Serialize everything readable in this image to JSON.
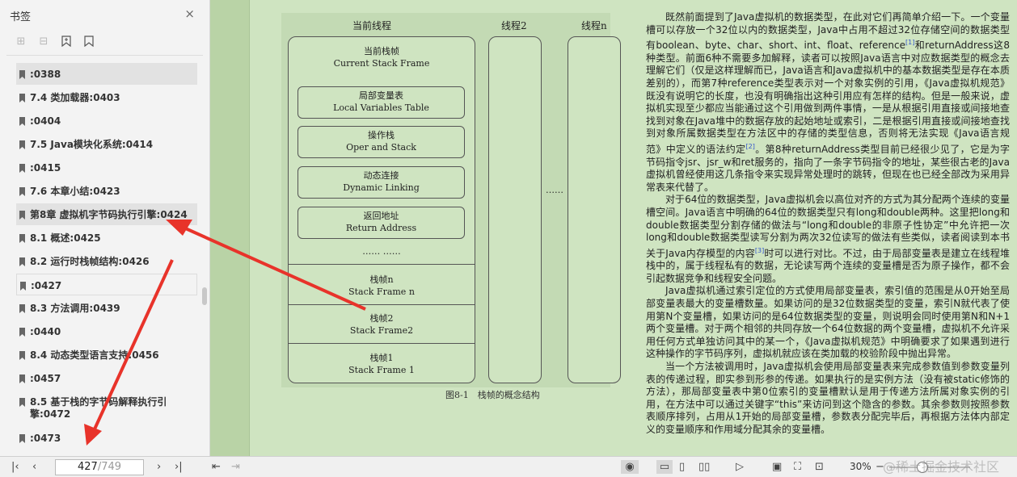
{
  "sidebar": {
    "title": "书签",
    "close": "×",
    "bookmarks": [
      ":0388",
      "7.4 类加载器:0403",
      ":0404",
      "7.5 Java模块化系统:0414",
      ":0415",
      "7.6 本章小结:0423",
      "第8章 虚拟机字节码执行引擎:0424",
      "8.1 概述:0425",
      "8.2 运行时栈帧结构:0426",
      ":0427",
      "8.3 方法调用:0439",
      ":0440",
      "8.4 动态类型语言支持:0456",
      ":0457",
      "8.5 基于栈的字节码解释执行引擎:0472",
      ":0473"
    ]
  },
  "figure": {
    "col1": "当前线程",
    "col2": "线程2",
    "col3": "线程n",
    "current_frame_cn": "当前栈帧",
    "current_frame_en": "Current Stack Frame",
    "lvt_cn": "局部变量表",
    "lvt_en": "Local Variables Table",
    "os_cn": "操作栈",
    "os_en": "Oper and Stack",
    "dl_cn": "动态连接",
    "dl_en": "Dynamic Linking",
    "ra_cn": "返回地址",
    "ra_en": "Return Address",
    "dots": "……  ……",
    "dots2": "……",
    "fn_cn": "栈帧n",
    "fn_en": "Stack Frame n",
    "f2_cn": "栈帧2",
    "f2_en": "Stack Frame2",
    "f1_cn": "栈帧1",
    "f1_en": "Stack Frame 1",
    "caption": "图8-1　栈帧的概念结构"
  },
  "text": {
    "p1a": "既然前面提到了Java虚拟机的数据类型，在此对它们再简单介绍一下。一个变量槽可以存放一个32位以内的数据类型，Java中占用不超过32位存储空间的数据类型有boolean、byte、char、short、int、float、reference",
    "p1sup1": "[1]",
    "p1b": "和returnAddress这8种类型。前面6种不需要多加解释，读者可以按照Java语言中对应数据类型的概念去理解它们（仅是这样理解而已，Java语言和Java虚拟机中的基本数据类型是存在本质差别的），而第7种reference类型表示对一个对象实例的引用，《Java虚拟机规范》既没有说明它的长度，也没有明确指出这种引用应有怎样的结构。但是一般来说，虚拟机实现至少都应当能通过这个引用做到两件事情，一是从根据引用直接或间接地查找到对象在Java堆中的数据存放的起始地址或索引，二是根据引用直接或间接地查找到对象所属数据类型在方法区中的存储的类型信息，否则将无法实现《Java语言规范》中定义的语法约定",
    "p1sup2": "[2]",
    "p1c": "。第8种returnAddress类型目前已经很少见了，它是为字节码指令jsr、jsr_w和ret服务的，指向了一条字节码指令的地址，某些很古老的Java虚拟机曾经使用这几条指令来实现异常处理时的跳转，但现在也已经全部改为采用异常表来代替了。",
    "p2a": "对于64位的数据类型，Java虚拟机会以高位对齐的方式为其分配两个连续的变量槽空间。Java语言中明确的64位的数据类型只有long和double两种。这里把long和double数据类型分割存储的做法与“long和double的非原子性协定”中允许把一次long和double数据类型读写分割为两次32位读写的做法有些类似，读者阅读到本书关于Java内存模型的内容",
    "p2sup": "[3]",
    "p2b": "时可以进行对比。不过，由于局部变量表是建立在线程堆栈中的，属于线程私有的数据，无论读写两个连续的变量槽是否为原子操作，都不会引起数据竞争和线程安全问题。",
    "p3": "Java虚拟机通过索引定位的方式使用局部变量表，索引值的范围是从0开始至局部变量表最大的变量槽数量。如果访问的是32位数据类型的变量，索引N就代表了使用第N个变量槽，如果访问的是64位数据类型的变量，则说明会同时使用第N和N+1两个变量槽。对于两个相邻的共同存放一个64位数据的两个变量槽，虚拟机不允许采用任何方式单独访问其中的某一个，《Java虚拟机规范》中明确要求了如果遇到进行这种操作的字节码序列，虚拟机就应该在类加载的校验阶段中抛出异常。",
    "p4": "当一个方法被调用时，Java虚拟机会使用局部变量表来完成参数值到参数变量列表的传递过程，即实参到形参的传递。如果执行的是实例方法（没有被static修饰的方法），那局部变量表中第0位索引的变量槽默认是用于传递方法所属对象实例的引用，在方法中可以通过关键字“this”来访问到这个隐含的参数。其余参数则按照参数表顺序排列，占用从1开始的局部变量槽，参数表分配完毕后，再根据方法体内部定义的变量顺序和作用域分配其余的变量槽。"
  },
  "status": {
    "current_page": "427",
    "total_pages": "/749",
    "zoom": "30%",
    "watermark": "@稀土掘金技术社区"
  },
  "colors": {
    "page": "#cfe4c1",
    "figure": "#c3dab4",
    "arrow": "#e8332a"
  }
}
